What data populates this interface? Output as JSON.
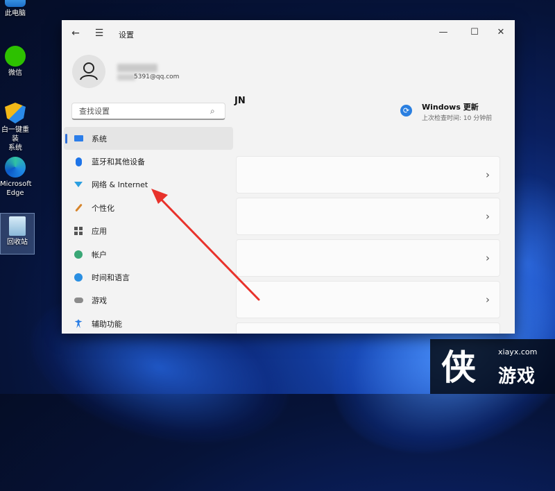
{
  "desktop": {
    "icons": [
      {
        "label": "此电脑",
        "icon": "computer-icon"
      },
      {
        "label": "微信",
        "icon": "wechat-icon"
      },
      {
        "label": "白一键重装系统",
        "label_line1": "白一键重装",
        "label_line2": "系统",
        "icon": "reinstall-shield-icon"
      },
      {
        "label_line1": "Microsoft",
        "label_line2": "Edge",
        "icon": "edge-icon"
      },
      {
        "label": "回收站",
        "icon": "recycle-bin-icon"
      }
    ]
  },
  "window": {
    "title": "设置",
    "back_icon": "arrow-left-icon",
    "menu_icon": "hamburger-icon",
    "controls": [
      "minimize",
      "maximize",
      "close"
    ]
  },
  "account": {
    "email": "5391@qq.com",
    "name_tail": "JN"
  },
  "search": {
    "placeholder": "查找设置"
  },
  "nav": {
    "items": [
      {
        "label": "系统",
        "icon": "monitor-icon",
        "active": true
      },
      {
        "label": "蓝牙和其他设备",
        "icon": "bluetooth-icon"
      },
      {
        "label": "网络 & Internet",
        "icon": "wifi-icon"
      },
      {
        "label": "个性化",
        "icon": "brush-icon"
      },
      {
        "label": "应用",
        "icon": "apps-icon"
      },
      {
        "label": "帐户",
        "icon": "person-icon"
      },
      {
        "label": "时间和语言",
        "icon": "globe-clock-icon"
      },
      {
        "label": "游戏",
        "icon": "gamepad-icon"
      },
      {
        "label": "辅助功能",
        "icon": "accessibility-icon"
      }
    ]
  },
  "update": {
    "title": "Windows 更新",
    "subtitle": "上次检查时间: 10 分钟前"
  },
  "colors": {
    "accent": "#2f6fd8",
    "annotation_arrow": "#e8322b"
  },
  "watermark": {
    "site": "xiayx.com",
    "brand": "游戏",
    "logo_char": "侠"
  }
}
